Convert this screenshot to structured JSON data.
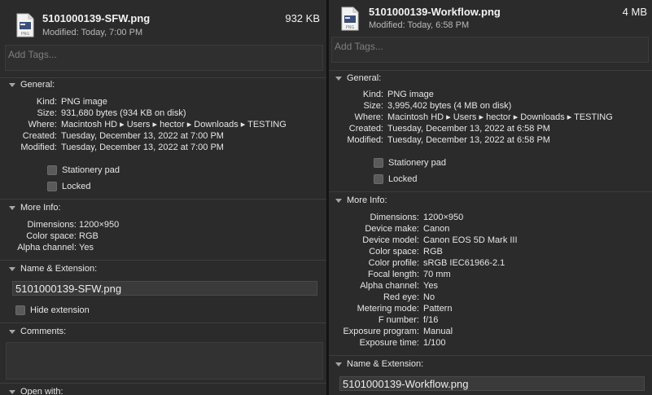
{
  "left": {
    "file_name": "5101000139-SFW.png",
    "file_size": "932 KB",
    "modified_short": "Modified: Today, 7:00 PM",
    "tags_placeholder": "Add Tags...",
    "general_title": "General:",
    "general": [
      {
        "k": "Kind:",
        "v": "PNG image"
      },
      {
        "k": "Size:",
        "v": "931,680 bytes (934 KB on disk)"
      },
      {
        "k": "Where:",
        "v": "Macintosh HD ▸ Users ▸ hector ▸ Downloads ▸ TESTING"
      },
      {
        "k": "Created:",
        "v": "Tuesday, December 13, 2022 at 7:00 PM"
      },
      {
        "k": "Modified:",
        "v": "Tuesday, December 13, 2022 at 7:00 PM"
      }
    ],
    "stationery_label": "Stationery pad",
    "locked_label": "Locked",
    "more_info_title": "More Info:",
    "more_info": [
      {
        "k": "Dimensions:",
        "v": "1200×950"
      },
      {
        "k": "Color space:",
        "v": "RGB"
      },
      {
        "k": "Alpha channel:",
        "v": "Yes"
      }
    ],
    "name_ext_title": "Name & Extension:",
    "name_field": "5101000139-SFW.png",
    "hide_ext_label": "Hide extension",
    "comments_title": "Comments:",
    "open_with_title": "Open with:"
  },
  "right": {
    "file_name": "5101000139-Workflow.png",
    "file_size": "4 MB",
    "modified_short": "Modified: Today, 6:58 PM",
    "tags_placeholder": "Add Tags...",
    "general_title": "General:",
    "general": [
      {
        "k": "Kind:",
        "v": "PNG image"
      },
      {
        "k": "Size:",
        "v": "3,995,402 bytes (4 MB on disk)"
      },
      {
        "k": "Where:",
        "v": "Macintosh HD ▸ Users ▸ hector ▸ Downloads ▸ TESTING"
      },
      {
        "k": "Created:",
        "v": "Tuesday, December 13, 2022 at 6:58 PM"
      },
      {
        "k": "Modified:",
        "v": "Tuesday, December 13, 2022 at 6:58 PM"
      }
    ],
    "stationery_label": "Stationery pad",
    "locked_label": "Locked",
    "more_info_title": "More Info:",
    "more_info": [
      {
        "k": "Dimensions:",
        "v": "1200×950"
      },
      {
        "k": "Device make:",
        "v": "Canon"
      },
      {
        "k": "Device model:",
        "v": "Canon EOS 5D Mark III"
      },
      {
        "k": "Color space:",
        "v": "RGB"
      },
      {
        "k": "Color profile:",
        "v": "sRGB IEC61966-2.1"
      },
      {
        "k": "Focal length:",
        "v": "70 mm"
      },
      {
        "k": "Alpha channel:",
        "v": "Yes"
      },
      {
        "k": "Red eye:",
        "v": "No"
      },
      {
        "k": "Metering mode:",
        "v": "Pattern"
      },
      {
        "k": "F number:",
        "v": "f/16"
      },
      {
        "k": "Exposure program:",
        "v": "Manual"
      },
      {
        "k": "Exposure time:",
        "v": "1/100"
      }
    ],
    "name_ext_title": "Name & Extension:",
    "name_field": "5101000139-Workflow.png"
  },
  "icons": {
    "file": "png-file-icon",
    "disclosure": "chevron-down-icon",
    "checkbox": "checkbox-icon"
  },
  "colors": {
    "panel_bg": "#2b2b2b",
    "field_bg": "#3a3a3a",
    "text": "#e6e6e6",
    "muted": "#b9b9b9"
  }
}
